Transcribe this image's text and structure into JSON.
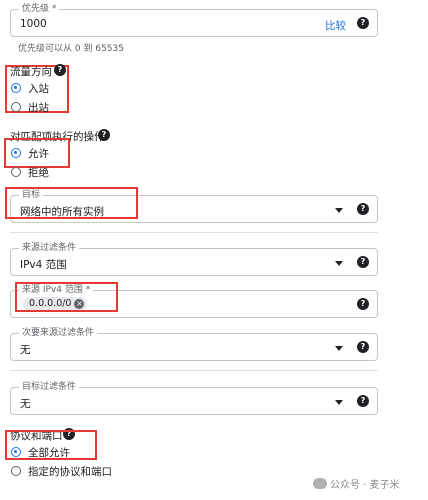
{
  "priority": {
    "label": "优先级 *",
    "value": "1000",
    "compare_link": "比较",
    "hint": "优先级可以从 0 到 65535"
  },
  "direction": {
    "title": "流量方向",
    "options": [
      "入站",
      "出站"
    ],
    "selected": 0
  },
  "action": {
    "title": "对匹配项执行的操作",
    "options": [
      "允许",
      "拒绝"
    ],
    "selected": 0
  },
  "target": {
    "label": "目标",
    "value": "网络中的所有实例"
  },
  "source_filter": {
    "label": "来源过滤条件",
    "value": "IPv4 范围"
  },
  "source_ipv4": {
    "label": "来源 IPv4 范围 *",
    "chip": "0.0.0.0/0"
  },
  "secondary_source_filter": {
    "label": "次要来源过滤条件",
    "value": "无"
  },
  "target_filter": {
    "label": "目标过滤条件",
    "value": "无"
  },
  "protocols": {
    "title": "协议和端口",
    "options": [
      "全部允许",
      "指定的协议和端口"
    ],
    "selected": 0
  },
  "watermark": "公众号 · 麦子米",
  "colors": {
    "accent": "#1a73e8",
    "highlight_box": "#e53935"
  }
}
